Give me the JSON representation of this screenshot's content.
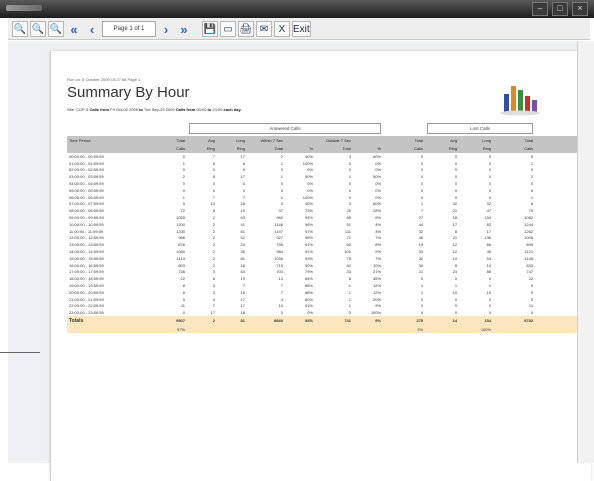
{
  "window": {
    "min_label": "–",
    "max_label": "□",
    "close_label": "×"
  },
  "toolbar": {
    "zoom_in": "🔍",
    "zoom_out": "🔍",
    "zoom_page": "🔍",
    "first": "«",
    "prev": "‹",
    "page_display": "Page 1 of 1",
    "next": "›",
    "last": "»",
    "save": "💾",
    "export": "▭",
    "print": "🖨",
    "email": "✉",
    "close_doc": "X",
    "exit": "Exit"
  },
  "report": {
    "meta": "Run on: 5 October 2009 15:27:58     Page 1",
    "title": "Summary By Hour",
    "sub_prefix": "Site: COP-5  ",
    "sub_bold1": "Calls from",
    "sub_mid1": " Fri Oct-02 2009 ",
    "sub_bold2": "to",
    "sub_mid2": " Tue Sep-29 2009  ",
    "sub_bold3": "Calls from",
    "sub_mid3": " 00:00 ",
    "sub_bold4": "to",
    "sub_mid4": " 23:59 ",
    "sub_bold5": "each day."
  },
  "groups": {
    "answered": "Answered Calls",
    "lost": "Lost Calls"
  },
  "columns": {
    "time": [
      "Time Period",
      ""
    ],
    "total": [
      "Total",
      "Calls"
    ],
    "avg_ring": [
      "Avg",
      "Ring"
    ],
    "long_ring": [
      "Long",
      "Ring"
    ],
    "within": [
      "Within 7 Sec",
      "Total"
    ],
    "within_pct": [
      "",
      "%"
    ],
    "outside": [
      "Outside 7 Sec",
      "Total"
    ],
    "outside_pct": [
      "",
      "%"
    ],
    "lost_total": [
      "Total",
      "Calls"
    ],
    "lost_avg": [
      "Avg",
      "Ring"
    ],
    "lost_long": [
      "Long",
      "Ring"
    ],
    "grand_total": [
      "Total",
      "Calls"
    ]
  },
  "rows": [
    [
      "00:00:00 - 00:59:59",
      "0",
      "7",
      "17",
      "2",
      "40%",
      "3",
      "60%",
      "0",
      "0",
      "0",
      "5"
    ],
    [
      "01:00:00 - 01:59:59",
      "1",
      "6",
      "6",
      "1",
      "100%",
      "0",
      "0%",
      "0",
      "0",
      "0",
      "1"
    ],
    [
      "02:00:00 - 02:59:59",
      "0",
      "0",
      "0",
      "0",
      "0%",
      "0",
      "0%",
      "0",
      "0",
      "0",
      "0"
    ],
    [
      "03:00:00 - 03:59:59",
      "2",
      "8",
      "17",
      "1",
      "50%",
      "1",
      "50%",
      "0",
      "0",
      "0",
      "2"
    ],
    [
      "04:00:00 - 04:59:59",
      "0",
      "0",
      "0",
      "0",
      "0%",
      "0",
      "0%",
      "0",
      "0",
      "0",
      "0"
    ],
    [
      "05:00:00 - 05:59:59",
      "0",
      "0",
      "0",
      "0",
      "0%",
      "0",
      "0%",
      "0",
      "0",
      "0",
      "0"
    ],
    [
      "06:00:00 - 06:59:59",
      "1",
      "7",
      "7",
      "1",
      "100%",
      "0",
      "0%",
      "0",
      "0",
      "0",
      "1"
    ],
    [
      "07:00:00 - 07:59:59",
      "5",
      "10",
      "18",
      "0",
      "40%",
      "3",
      "60%",
      "1",
      "32",
      "32",
      "6"
    ],
    [
      "08:00:00 - 08:59:59",
      "72",
      "8",
      "19",
      "37",
      "73%",
      "25",
      "28%",
      "7",
      "21",
      "47",
      "79"
    ],
    [
      "09:00:00 - 09:59:59",
      "1055",
      "2",
      "63",
      "960",
      "94%",
      "65",
      "6%",
      "27",
      "18",
      "154",
      "1082"
    ],
    [
      "10:00:00 - 10:59:59",
      "1200",
      "2",
      "41",
      "1146",
      "96%",
      "51",
      "4%",
      "44",
      "17",
      "82",
      "1244"
    ],
    [
      "11:00:00 - 11:59:59",
      "1230",
      "2",
      "61",
      "1197",
      "97%",
      "111",
      "3%",
      "32",
      "8",
      "17",
      "1262"
    ],
    [
      "12:00:00 - 12:59:59",
      "966",
      "2",
      "52",
      "927",
      "96%",
      "71",
      "7%",
      "46",
      "21",
      "136",
      "1006"
    ],
    [
      "13:00:00 - 13:59:59",
      "876",
      "2",
      "24",
      "795",
      "91%",
      "65",
      "8%",
      "19",
      "12",
      "66",
      "895"
    ],
    [
      "14:00:00 - 14:59:59",
      "1080",
      "2",
      "35",
      "984",
      "91%",
      "101",
      "9%",
      "33",
      "12",
      "46",
      "1121"
    ],
    [
      "15:00:00 - 15:59:59",
      "1113",
      "2",
      "81",
      "1036",
      "93%",
      "75",
      "7%",
      "32",
      "10",
      "54",
      "1145"
    ],
    [
      "16:00:00 - 16:59:59",
      "803",
      "2",
      "18",
      "719",
      "90%",
      "84",
      "10%",
      "30",
      "8",
      "14",
      "833"
    ],
    [
      "17:00:00 - 17:59:59",
      "736",
      "3",
      "63",
      "703",
      "79%",
      "33",
      "21%",
      "11",
      "23",
      "66",
      "747"
    ],
    [
      "18:00:00 - 18:59:59",
      "22",
      "8",
      "19",
      "14",
      "64%",
      "8",
      "36%",
      "0",
      "0",
      "0",
      "22"
    ],
    [
      "19:00:00 - 19:59:59",
      "8",
      "3",
      "7",
      "7",
      "88%",
      "1",
      "12%",
      "1",
      "1",
      "1",
      "9"
    ],
    [
      "20:00:00 - 20:59:59",
      "8",
      "3",
      "16",
      "7",
      "88%",
      "1",
      "12%",
      "1",
      "10",
      "10",
      "9"
    ],
    [
      "21:00:00 - 21:59:59",
      "5",
      "4",
      "17",
      "4",
      "80%",
      "1",
      "20%",
      "0",
      "0",
      "0",
      "5"
    ],
    [
      "22:00:00 - 22:59:59",
      "11",
      "7",
      "17",
      "10",
      "91%",
      "1",
      "9%",
      "0",
      "0",
      "0",
      "11"
    ],
    [
      "23:00:00 - 23:59:59",
      "0",
      "17",
      "18",
      "0",
      "0%",
      "3",
      "100%",
      "0",
      "0",
      "0",
      "0"
    ]
  ],
  "totals": {
    "label": "Totals",
    "row1": [
      "9507",
      "2",
      "81",
      "8840",
      "93%",
      "741",
      "9%",
      "275",
      "14",
      "154",
      "9782"
    ],
    "row2": [
      "97%",
      "",
      "",
      "",
      "",
      "",
      "",
      "3%",
      "",
      "100%",
      ""
    ]
  }
}
